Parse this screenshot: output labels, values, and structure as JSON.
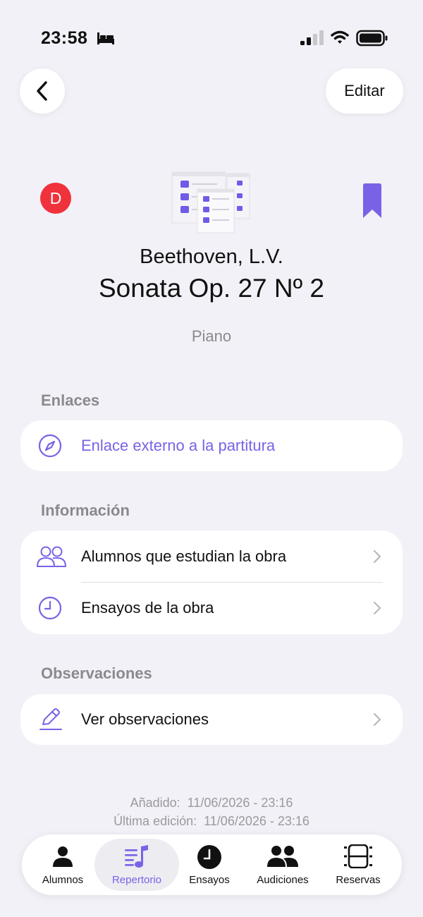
{
  "status_bar": {
    "time": "23:58"
  },
  "header": {
    "back_icon": "chevron-left-icon",
    "edit_label": "Editar"
  },
  "work": {
    "badge_letter": "D",
    "composer": "Beethoven, L.V.",
    "title": "Sonata Op. 27 Nº 2",
    "instrument": "Piano"
  },
  "sections": {
    "links": {
      "title": "Enlaces",
      "items": [
        {
          "label": "Enlace externo a la partitura",
          "icon": "compass-icon"
        }
      ]
    },
    "info": {
      "title": "Información",
      "items": [
        {
          "label": "Alumnos que estudian la obra",
          "icon": "people-icon"
        },
        {
          "label": "Ensayos de la obra",
          "icon": "clock-icon"
        }
      ]
    },
    "notes": {
      "title": "Observaciones",
      "items": [
        {
          "label": "Ver observaciones",
          "icon": "pencil-icon"
        }
      ]
    }
  },
  "meta": {
    "added_label": "Añadido:",
    "added_value": "11/06/2026 - 23:16",
    "edited_label": "Última edición:",
    "edited_value": "11/06/2026 - 23:16"
  },
  "tabbar": {
    "items": [
      {
        "label": "Alumnos",
        "icon": "person-icon",
        "active": false
      },
      {
        "label": "Repertorio",
        "icon": "music-list-icon",
        "active": true
      },
      {
        "label": "Ensayos",
        "icon": "clock-icon",
        "active": false
      },
      {
        "label": "Audiciones",
        "icon": "group-icon",
        "active": false
      },
      {
        "label": "Reservas",
        "icon": "rooms-icon",
        "active": false
      }
    ]
  },
  "colors": {
    "accent": "#7a62e6",
    "badge_red": "#f0323c",
    "background": "#f2f1f7",
    "secondary_text": "#8a8a8e"
  }
}
